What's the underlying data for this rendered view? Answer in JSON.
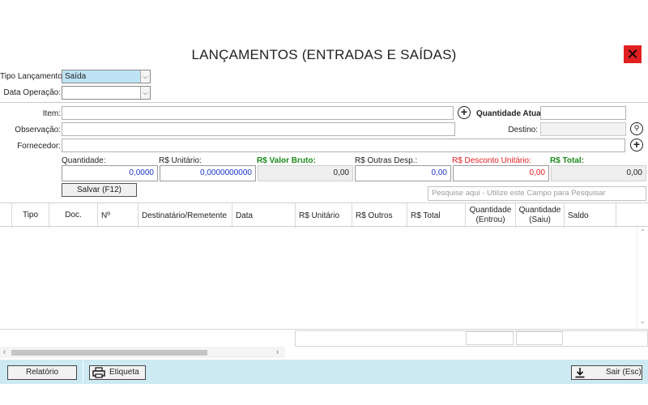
{
  "window": {
    "title": "LANÇAMENTOS (ENTRADAS E SAÍDAS)",
    "close_symbol": "✕"
  },
  "header": {
    "tipo_lancamento_label": "Tipo Lançamento:",
    "tipo_lancamento_value": "Saída",
    "data_operacao_label": "Data Operação:",
    "data_operacao_value": ""
  },
  "form": {
    "item_label": "Item:",
    "quantidade_atual_label": "Quantidade Atual:",
    "observacao_label": "Observação:",
    "destino_label": "Destino:",
    "fornecedor_label": "Fornecedor:"
  },
  "values": {
    "quantidade_label": "Quantidade:",
    "quantidade_value": "0,0000",
    "unitario_label": "R$ Unitário:",
    "unitario_value": "0,0000000000",
    "valor_bruto_label": "R$ Valor Bruto:",
    "valor_bruto_value": "0,00",
    "outras_desp_label": "R$ Outras Desp.:",
    "outras_desp_value": "0,00",
    "desconto_label": "R$ Desconto Unitário:",
    "desconto_value": "0,00",
    "total_label": "R$ Total:",
    "total_value": "0,00"
  },
  "actions": {
    "salvar_label": "Salvar (F12)",
    "search_placeholder": "Pesquise aqui - Utilize este Campo para Pesquisar"
  },
  "table": {
    "columns": [
      "Tipo",
      "Doc.",
      "Nº",
      "Destinatário/Remetente",
      "Data",
      "R$ Unitário",
      "R$ Outros",
      "R$ Total",
      "Quantidade\n(Entrou)",
      "Quantidade\n(Saiu)",
      "Saldo"
    ]
  },
  "footer": {
    "relatorio_label": "Relatório",
    "etiqueta_label": "Etiqueta",
    "sair_label": "Sair (Esc)"
  },
  "colors": {
    "accent_bar": "#cdeaf2",
    "close_red": "#e02020",
    "green_label": "#1a8a1a",
    "red_label": "#e02020",
    "blue_value": "#1a35c8"
  },
  "icons": {
    "plus": "add-icon",
    "search": "search-icon",
    "printer": "printer-icon",
    "exit": "download-exit-icon"
  }
}
